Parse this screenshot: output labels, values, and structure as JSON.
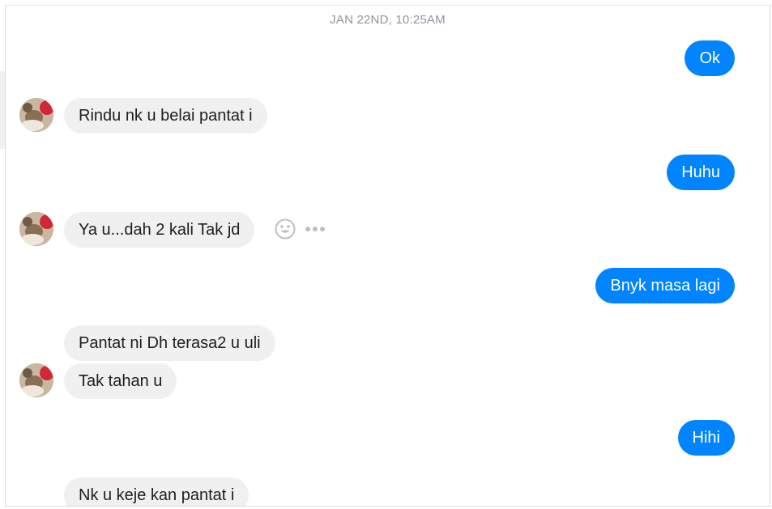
{
  "thread": {
    "timestamp": "JAN 22ND, 10:25AM",
    "messages": [
      {
        "id": "m1",
        "from": "me",
        "text": "Ok"
      },
      {
        "id": "m2",
        "from": "them",
        "text": "Rindu nk u belai pantat i"
      },
      {
        "id": "m3",
        "from": "me",
        "text": "Huhu"
      },
      {
        "id": "m4",
        "from": "them",
        "text": "Ya u...dah 2 kali Tak jd"
      },
      {
        "id": "m5",
        "from": "me",
        "text": "Bnyk masa lagi"
      },
      {
        "id": "m6",
        "from": "them",
        "text": "Pantat ni Dh terasa2 u uli"
      },
      {
        "id": "m7",
        "from": "them",
        "text": "Tak tahan u"
      },
      {
        "id": "m8",
        "from": "me",
        "text": "Hihi"
      },
      {
        "id": "m9",
        "from": "them",
        "text": "Nk u keje kan pantat i"
      }
    ]
  },
  "icons": {
    "react": "smiley-reaction-icon",
    "more": "more-options-icon"
  },
  "colors": {
    "outgoing_bubble": "#0084ff",
    "incoming_bubble": "#f1f0f0",
    "timestamp_text": "#90949c"
  }
}
